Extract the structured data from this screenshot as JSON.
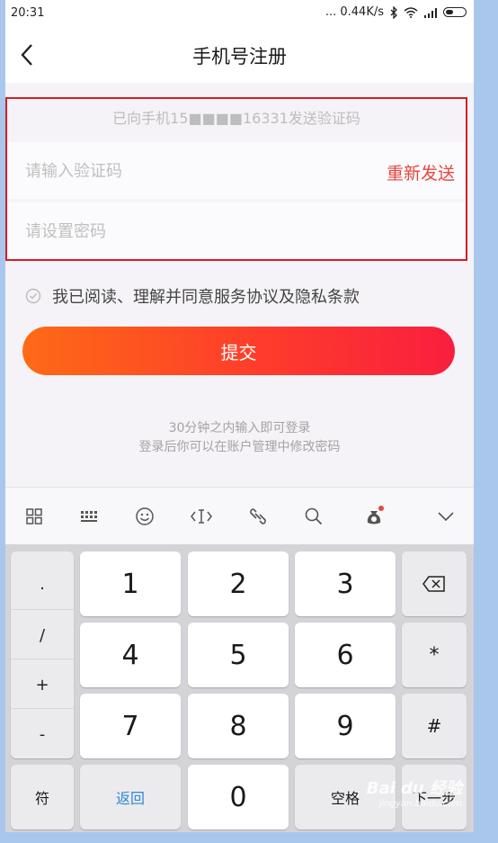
{
  "status": {
    "time": "20:31",
    "network_speed": "... 0.44K/s",
    "icons": [
      "bluetooth-icon",
      "wifi-icon",
      "signal-icon",
      "battery-icon"
    ]
  },
  "header": {
    "title": "手机号注册",
    "back_icon": "chevron-left-icon"
  },
  "form": {
    "sent_hint": "已向手机15■■■■16331发送验证码",
    "code_placeholder": "请输入验证码",
    "resend_label": "重新发送",
    "password_placeholder": "请设置密码"
  },
  "agreement": {
    "text": "我已阅读、理解并同意服务协议及隐私条款"
  },
  "submit_label": "提交",
  "notes": {
    "line1": "30分钟之内输入即可登录",
    "line2": "登录后你可以在账户管理中修改密码"
  },
  "keyboard_toolbar": {
    "icons": [
      "grid-icon",
      "keyboard-icon",
      "emoji-icon",
      "cursor-icon",
      "link-icon",
      "search-icon",
      "bag-icon",
      "chevron-down-icon"
    ]
  },
  "keyboard": {
    "symbols": [
      ".",
      "/",
      "+",
      "-"
    ],
    "digits": [
      "1",
      "2",
      "3",
      "4",
      "5",
      "6",
      "7",
      "8",
      "9",
      "0"
    ],
    "star": "*",
    "hash": "#",
    "symbol_key": "符",
    "back_key": "返回",
    "space_key": "空格",
    "next_key": "下一步"
  },
  "watermark": {
    "brand": "Bai du 经验",
    "url": "jingyan.baidu.com"
  },
  "colors": {
    "accent": "#e8463e",
    "highlight_border": "#d51d28",
    "button_start": "#fe6a16",
    "button_end": "#f91e3f"
  }
}
